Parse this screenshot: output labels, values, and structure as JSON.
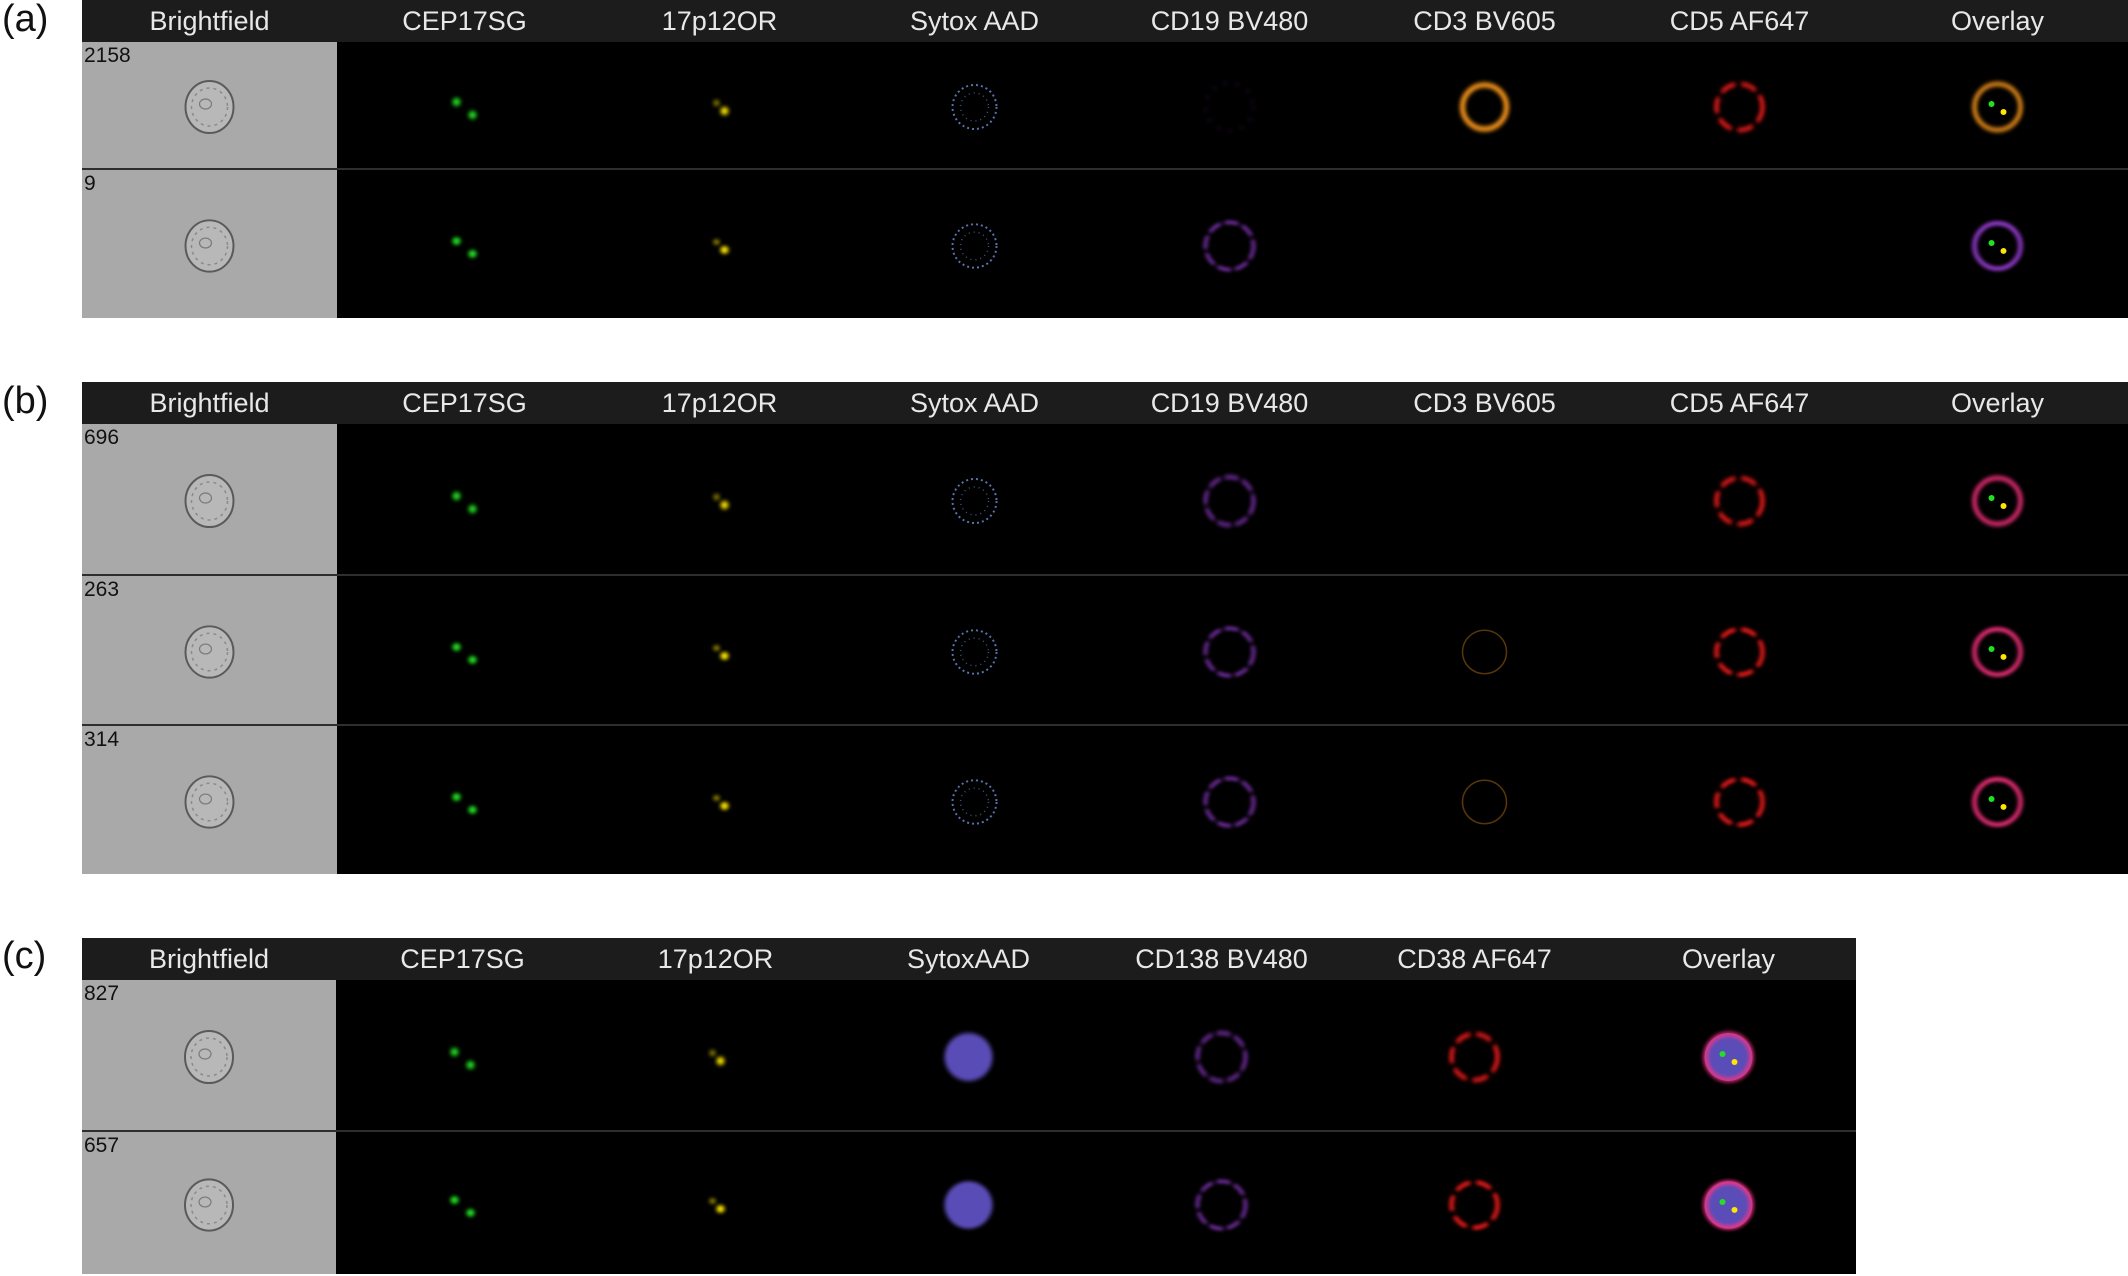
{
  "panels": [
    {
      "label": "(a)",
      "channels": [
        "Brightfield",
        "CEP17SG",
        "17p12OR",
        "Sytox AAD",
        "CD19 BV480",
        "CD3 BV605",
        "CD5 AF647",
        "Overlay"
      ],
      "rows": [
        {
          "object_number": "2158"
        },
        {
          "object_number": "9"
        }
      ]
    },
    {
      "label": "(b)",
      "channels": [
        "Brightfield",
        "CEP17SG",
        "17p12OR",
        "Sytox AAD",
        "CD19 BV480",
        "CD3 BV605",
        "CD5 AF647",
        "Overlay"
      ],
      "rows": [
        {
          "object_number": "696"
        },
        {
          "object_number": "263"
        },
        {
          "object_number": "314"
        }
      ]
    },
    {
      "label": "(c)",
      "channels": [
        "Brightfield",
        "CEP17SG",
        "17p12OR",
        "SytoxAAD",
        "CD138 BV480",
        "CD38 AF647",
        "Overlay"
      ],
      "rows": [
        {
          "object_number": "827"
        },
        {
          "object_number": "657"
        }
      ]
    }
  ],
  "colors": {
    "green": "#22e022",
    "yellow": "#ffe600",
    "blue": "#6d8fd8",
    "purple": "#a040e0",
    "orange": "#ff9a1a",
    "red": "#ff1a1a",
    "nucleus_violet": "#6a5ad8"
  }
}
